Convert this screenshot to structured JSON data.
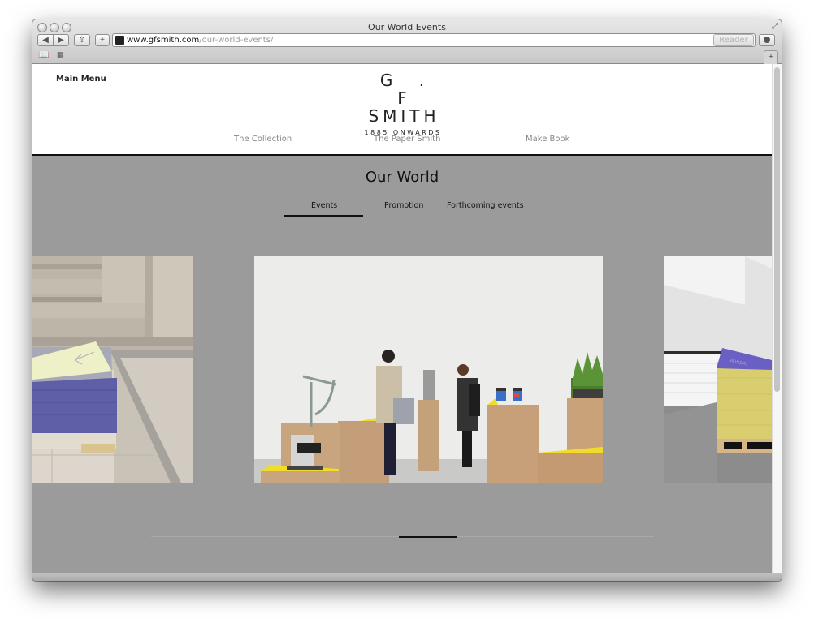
{
  "browser": {
    "window_title": "Our World Events",
    "url_domain": "www.gfsmith.com",
    "url_path": "/our-world-events/",
    "reader_label": "Reader",
    "new_tab_label": "+",
    "back_label": "◀",
    "forward_label": "▶",
    "add_label": "+",
    "reload_label": "↻"
  },
  "site": {
    "main_menu_label": "Main Menu",
    "logo": {
      "line1": "G.F",
      "line2": "SMITH",
      "line3": "1885 ONWARDS"
    },
    "nav": [
      {
        "label": "The Collection"
      },
      {
        "label": "The Paper Smith"
      },
      {
        "label": "Make Book"
      }
    ]
  },
  "page": {
    "title": "Our World",
    "tabs": [
      {
        "label": "Events",
        "active": true
      },
      {
        "label": "Promotion",
        "active": false
      },
      {
        "label": "Forthcoming events",
        "active": false
      }
    ],
    "carousel": {
      "slides": [
        {
          "description": "Stack of blue and pale yellow paper on pallet in stone stairwell"
        },
        {
          "description": "Exhibition with OSB plinths, microscope, scale, jars and plant; two visitors"
        },
        {
          "description": "Stack of yellow paper with purple 'MONDAY' sheet on pallet in white room"
        }
      ],
      "slide_text": "MONDAY",
      "position": 0.5
    }
  }
}
